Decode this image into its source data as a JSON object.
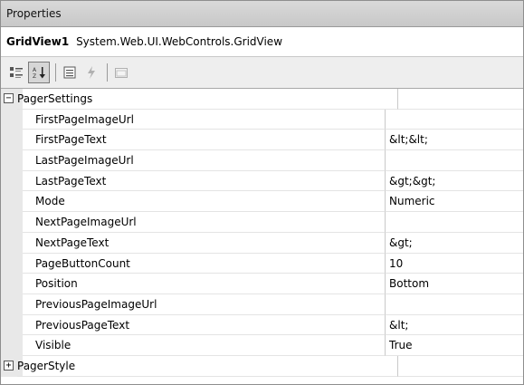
{
  "window": {
    "title": "Properties"
  },
  "object": {
    "name": "GridView1",
    "type": "System.Web.UI.WebControls.GridView"
  },
  "toolbar": {
    "buttons": [
      {
        "icon": "categorized-icon",
        "active": false
      },
      {
        "icon": "alphabetical-icon",
        "active": true
      },
      {
        "icon": "properties-icon",
        "active": false
      },
      {
        "icon": "events-icon",
        "active": false
      },
      {
        "icon": "property-pages-icon",
        "active": false
      }
    ]
  },
  "grid": {
    "categories": [
      {
        "name": "PagerSettings",
        "expanded": true,
        "expander": "⊟",
        "properties": [
          {
            "name": "FirstPageImageUrl",
            "value": ""
          },
          {
            "name": "FirstPageText",
            "value": "&lt;&lt;"
          },
          {
            "name": "LastPageImageUrl",
            "value": ""
          },
          {
            "name": "LastPageText",
            "value": "&gt;&gt;"
          },
          {
            "name": "Mode",
            "value": "Numeric"
          },
          {
            "name": "NextPageImageUrl",
            "value": ""
          },
          {
            "name": "NextPageText",
            "value": "&gt;"
          },
          {
            "name": "PageButtonCount",
            "value": "10"
          },
          {
            "name": "Position",
            "value": "Bottom"
          },
          {
            "name": "PreviousPageImageUrl",
            "value": ""
          },
          {
            "name": "PreviousPageText",
            "value": "&lt;"
          },
          {
            "name": "Visible",
            "value": "True"
          }
        ]
      },
      {
        "name": "PagerStyle",
        "expanded": false,
        "expander": "⊞",
        "properties": []
      }
    ]
  }
}
